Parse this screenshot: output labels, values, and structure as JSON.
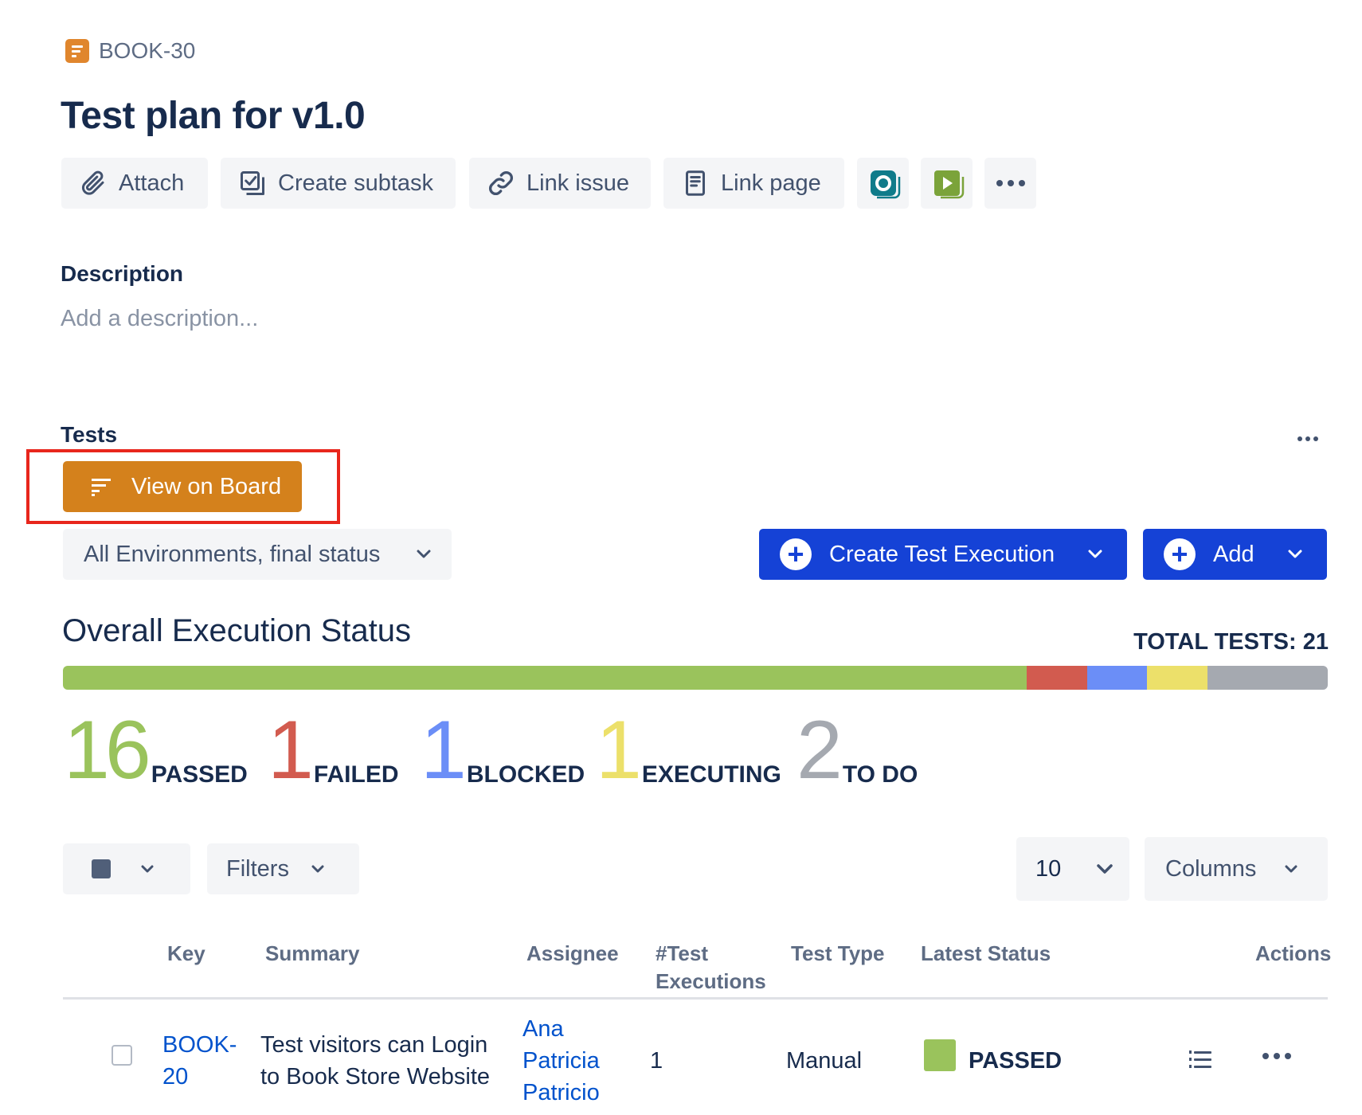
{
  "issue": {
    "key": "BOOK-30",
    "title": "Test plan for v1.0"
  },
  "toolbar": {
    "attach_label": "Attach",
    "create_subtask_label": "Create subtask",
    "link_issue_label": "Link issue",
    "link_page_label": "Link page",
    "app_icons": [
      "app-o-icon",
      "app-play-icon"
    ],
    "more_icon": "ellipsis-icon"
  },
  "description": {
    "heading": "Description",
    "placeholder": "Add a description..."
  },
  "tests": {
    "heading": "Tests",
    "view_on_board_label": "View on Board",
    "environment_select": "All Environments, final status",
    "create_execution_label": "Create Test Execution",
    "add_label": "Add"
  },
  "execution_status": {
    "title": "Overall Execution Status",
    "total_label": "TOTAL TESTS: 21",
    "total": 21,
    "stats": [
      {
        "count": "16",
        "label": "PASSED",
        "color": "#9ac35c"
      },
      {
        "count": "1",
        "label": "FAILED",
        "color": "#d25b4f"
      },
      {
        "count": "1",
        "label": "BLOCKED",
        "color": "#6b8ef7"
      },
      {
        "count": "1",
        "label": "EXECUTING",
        "color": "#ece06a"
      },
      {
        "count": "2",
        "label": "TO DO",
        "color": "#a5a9b0"
      }
    ]
  },
  "table_controls": {
    "filters_label": "Filters",
    "page_size": "10",
    "columns_label": "Columns"
  },
  "table": {
    "headers": {
      "key": "Key",
      "summary": "Summary",
      "assignee": "Assignee",
      "executions_1": "#Test",
      "executions_2": "Executions",
      "test_type": "Test Type",
      "latest_status": "Latest Status",
      "actions": "Actions"
    },
    "rows": [
      {
        "key_1": "BOOK-",
        "key_2": "20",
        "summary_1": "Test visitors can Login",
        "summary_2": "to Book Store Website",
        "assignee_1": "Ana",
        "assignee_2": "Patricia",
        "assignee_3": "Patricio",
        "executions": "1",
        "test_type": "Manual",
        "latest_status": "PASSED",
        "status_color": "#9ac35c"
      }
    ]
  }
}
